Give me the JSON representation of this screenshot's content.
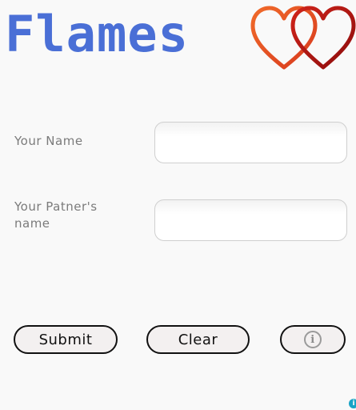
{
  "app": {
    "title": "Flames"
  },
  "form": {
    "name_label": "Your Name",
    "partner_label": "Your Patner's name",
    "name_value": "",
    "partner_value": ""
  },
  "buttons": {
    "submit_label": "Submit",
    "clear_label": "Clear",
    "info_icon": "info-icon"
  },
  "decor": {
    "hearts_icon": "double-hearts-icon",
    "corner_icon": "ad-info-icon"
  },
  "colors": {
    "title": "#4a6fd6",
    "heart_left": "#e8512a",
    "heart_right": "#b01414"
  }
}
